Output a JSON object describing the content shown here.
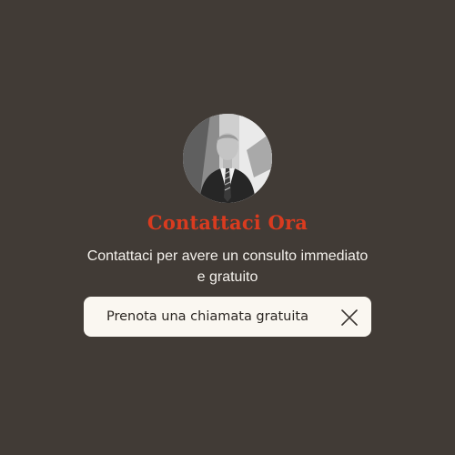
{
  "contact": {
    "avatar_icon": "person-photo-icon",
    "title": "Contattaci Ora",
    "subtitle": "Contattaci per avere un consulto immediato e gratuito",
    "cta_label": "Prenota una chiamata gratuita",
    "close_icon": "close-icon"
  },
  "colors": {
    "background": "#413b36",
    "title": "#d93b1f",
    "subtitle": "#f4f1ec",
    "button_bg": "#faf7f1",
    "button_text": "#2b2622"
  }
}
